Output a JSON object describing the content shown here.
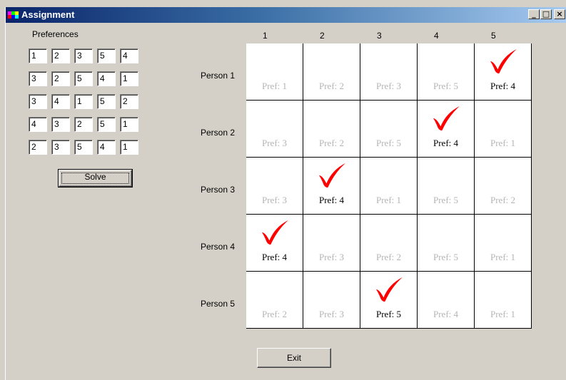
{
  "window": {
    "title": "Assignment",
    "controls": {
      "minimize": "_",
      "maximize": "□",
      "close": "×"
    }
  },
  "preferences": {
    "label": "Preferences",
    "matrix": [
      [
        "1",
        "2",
        "3",
        "5",
        "4"
      ],
      [
        "3",
        "2",
        "5",
        "4",
        "1"
      ],
      [
        "3",
        "4",
        "1",
        "5",
        "2"
      ],
      [
        "4",
        "3",
        "2",
        "5",
        "1"
      ],
      [
        "2",
        "3",
        "5",
        "4",
        "1"
      ]
    ]
  },
  "solve_label": "Solve",
  "exit_label": "Exit",
  "columns": [
    "1",
    "2",
    "3",
    "4",
    "5"
  ],
  "persons": [
    "Person 1",
    "Person 2",
    "Person 3",
    "Person 4",
    "Person 5"
  ],
  "grid": {
    "prefs": [
      [
        "Pref: 1",
        "Pref: 2",
        "Pref: 3",
        "Pref: 5",
        "Pref: 4"
      ],
      [
        "Pref: 3",
        "Pref: 2",
        "Pref: 5",
        "Pref: 4",
        "Pref: 1"
      ],
      [
        "Pref: 3",
        "Pref: 4",
        "Pref: 1",
        "Pref: 5",
        "Pref: 2"
      ],
      [
        "Pref: 4",
        "Pref: 3",
        "Pref: 2",
        "Pref: 5",
        "Pref: 1"
      ],
      [
        "Pref: 2",
        "Pref: 3",
        "Pref: 5",
        "Pref: 4",
        "Pref: 1"
      ]
    ],
    "assigned_column": [
      5,
      4,
      2,
      1,
      3
    ]
  },
  "colors": {
    "check": "#ff0000",
    "dim_text": "#b4b4b4",
    "title_start": "#0a246a",
    "title_end": "#a6caf0"
  }
}
